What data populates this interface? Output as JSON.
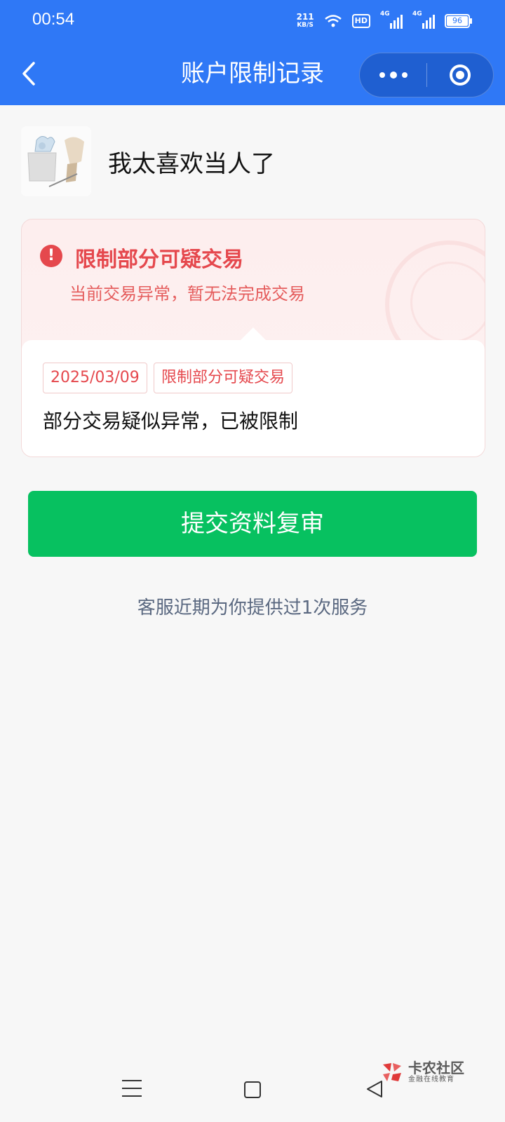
{
  "status_bar": {
    "time": "00:54",
    "net_speed": "211",
    "net_speed_unit": "KB/S",
    "hd_label": "HD",
    "signal1_label": "4G",
    "signal2_label": "4G",
    "battery": "96"
  },
  "nav": {
    "title": "账户限制记录",
    "back_icon": "chevron-left-icon",
    "more_icon": "more-dots-icon",
    "close_icon": "target-circle-icon"
  },
  "user": {
    "name": "我太喜欢当人了"
  },
  "restriction": {
    "title": "限制部分可疑交易",
    "subtitle": "当前交易异常，暂无法完成交易",
    "date_tag": "2025/03/09",
    "type_tag": "限制部分可疑交易",
    "description": "部分交易疑似异常，已被限制",
    "accent_color": "#e5484d"
  },
  "actions": {
    "submit_label": "提交资料复审",
    "submit_color": "#07c160"
  },
  "service_note": "客服近期为你提供过1次服务",
  "watermark": {
    "title": "卡农社区",
    "subtitle": "金融在线教育"
  },
  "colors": {
    "header": "#2f78f6",
    "background": "#f7f7f7"
  }
}
